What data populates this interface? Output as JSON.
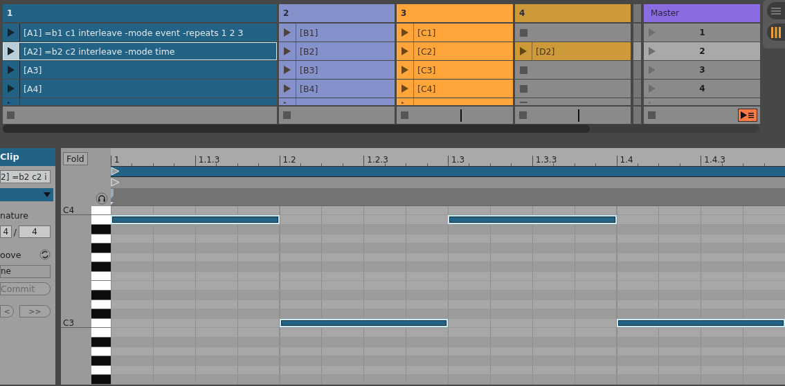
{
  "session": {
    "tracks": [
      {
        "name": "1",
        "color": "#226285",
        "show_marker": false,
        "slots": [
          {
            "kind": "clip",
            "label": "[A1] =b1 c1 interleave -mode event -repeats 1 2 3",
            "selected": false
          },
          {
            "kind": "clip",
            "label": "[A2] =b2 c2 interleave -mode time",
            "selected": true
          },
          {
            "kind": "clip",
            "label": "[A3]",
            "selected": false
          },
          {
            "kind": "clip",
            "label": "[A4]",
            "selected": false
          }
        ],
        "partial_slot": {
          "kind": "clip"
        }
      },
      {
        "name": "2",
        "color": "#8591cb",
        "show_marker": false,
        "slots": [
          {
            "kind": "clip",
            "label": "[B1]",
            "selected": false
          },
          {
            "kind": "clip",
            "label": "[B2]",
            "selected": false
          },
          {
            "kind": "clip",
            "label": "[B3]",
            "selected": false
          },
          {
            "kind": "clip",
            "label": "[B4]",
            "selected": false
          }
        ],
        "partial_slot": {
          "kind": "clip"
        }
      },
      {
        "name": "3",
        "color": "#ffa53a",
        "show_marker": true,
        "slots": [
          {
            "kind": "clip",
            "label": "[C1]",
            "selected": false
          },
          {
            "kind": "clip",
            "label": "[C2]",
            "selected": false
          },
          {
            "kind": "clip",
            "label": "[C3]",
            "selected": false
          },
          {
            "kind": "clip",
            "label": "[C4]",
            "selected": false
          }
        ],
        "partial_slot": {
          "kind": "clip"
        }
      },
      {
        "name": "4",
        "color": "#cc9a39",
        "show_marker": true,
        "slots": [
          {
            "kind": "empty",
            "selected": false
          },
          {
            "kind": "clip",
            "label": "[D2]",
            "selected": false
          },
          {
            "kind": "empty",
            "selected": false
          },
          {
            "kind": "empty",
            "selected": false
          }
        ],
        "partial_slot": {
          "kind": "empty"
        }
      }
    ],
    "master": {
      "name": "Master",
      "color": "#8b6ce0",
      "scenes": [
        {
          "label": "1",
          "selected": false
        },
        {
          "label": "2",
          "selected": true
        },
        {
          "label": "3",
          "selected": false
        },
        {
          "label": "4",
          "selected": false
        }
      ]
    }
  },
  "clip_panel": {
    "title": "Clip",
    "name_field": "2] =b2 c2 i",
    "signature_label": "nature",
    "signature_numerator": "4",
    "signature_separator": "/",
    "signature_denominator": "4",
    "groove_label": "oove",
    "groove_value": "ne",
    "commit_button": {
      "label": "Commit",
      "disabled": true
    },
    "nav_buttons": [
      "<",
      ">>"
    ]
  },
  "piano_roll": {
    "fold_button": "Fold",
    "ruler_labels": [
      "1",
      "1.1.3",
      "1.2",
      "1.2.3",
      "1.3",
      "1.3.3",
      "1.4",
      "1.4.3"
    ],
    "rows": [
      {
        "kind": "white",
        "label": "C4",
        "notes": [
          false,
          false,
          false,
          false
        ]
      },
      {
        "kind": "white",
        "notes": [
          true,
          false,
          true,
          false
        ]
      },
      {
        "kind": "black",
        "notes": [
          false,
          false,
          false,
          false
        ]
      },
      {
        "kind": "white",
        "notes": [
          false,
          false,
          false,
          false
        ]
      },
      {
        "kind": "black",
        "notes": [
          false,
          false,
          false,
          false
        ]
      },
      {
        "kind": "white",
        "notes": [
          false,
          false,
          false,
          false
        ]
      },
      {
        "kind": "black",
        "notes": [
          false,
          false,
          false,
          false
        ]
      },
      {
        "kind": "white",
        "notes": [
          false,
          false,
          false,
          false
        ]
      },
      {
        "kind": "white",
        "notes": [
          false,
          false,
          false,
          false
        ]
      },
      {
        "kind": "black",
        "notes": [
          false,
          false,
          false,
          false
        ]
      },
      {
        "kind": "white",
        "notes": [
          false,
          false,
          false,
          false
        ]
      },
      {
        "kind": "black",
        "notes": [
          false,
          false,
          false,
          false
        ]
      },
      {
        "kind": "white",
        "label": "C3",
        "notes": [
          false,
          true,
          false,
          true
        ]
      },
      {
        "kind": "white",
        "notes": [
          false,
          false,
          false,
          false
        ]
      },
      {
        "kind": "black",
        "notes": [
          false,
          false,
          false,
          false
        ]
      },
      {
        "kind": "white",
        "notes": [
          false,
          false,
          false,
          false
        ]
      },
      {
        "kind": "black",
        "notes": [
          false,
          false,
          false,
          false
        ]
      },
      {
        "kind": "white",
        "notes": [
          false,
          false,
          false,
          false
        ]
      },
      {
        "kind": "black",
        "notes": [
          false,
          false,
          false,
          false
        ]
      }
    ]
  }
}
